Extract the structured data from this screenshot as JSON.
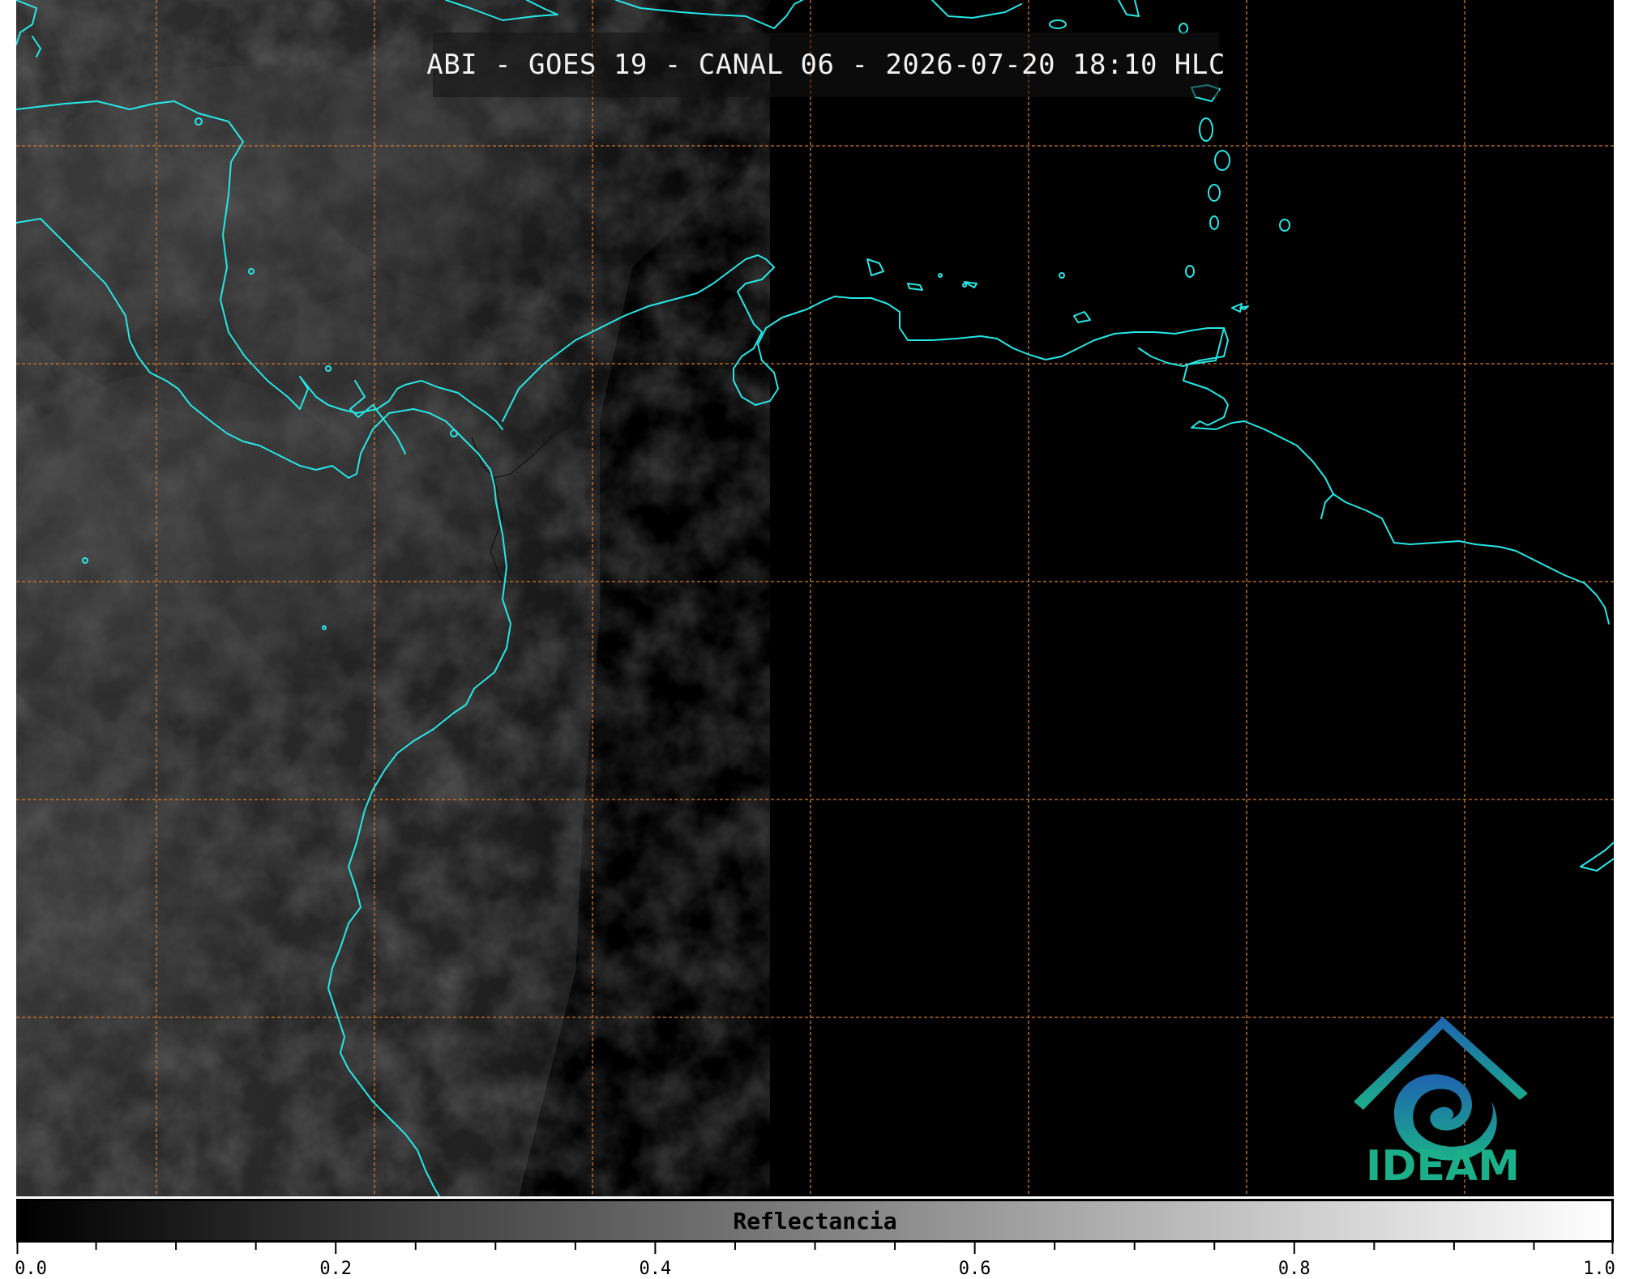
{
  "title": "ABI - GOES 19 - CANAL 06 - 2026-07-20 18:10 HLC",
  "colors": {
    "background": "#000000",
    "coastline": "#27e6e6",
    "grid": "#d77a2a",
    "logo_gradient_start": "#1f63b0",
    "logo_gradient_end": "#1bb089",
    "colorbar_start": "#000000",
    "colorbar_end": "#ffffff"
  },
  "logo": {
    "text": "IDEAM",
    "icon": "ideam-logo-icon"
  },
  "colorbar": {
    "label": "Reflectancia",
    "range": [
      0.0,
      1.0
    ],
    "ticks": [
      {
        "value": 0.0,
        "label": "0.0"
      },
      {
        "value": 0.2,
        "label": "0.2"
      },
      {
        "value": 0.4,
        "label": "0.4"
      },
      {
        "value": 0.6,
        "label": "0.6"
      },
      {
        "value": 0.8,
        "label": "0.8"
      },
      {
        "value": 1.0,
        "label": "1.0"
      }
    ],
    "minor_step": 0.05
  }
}
